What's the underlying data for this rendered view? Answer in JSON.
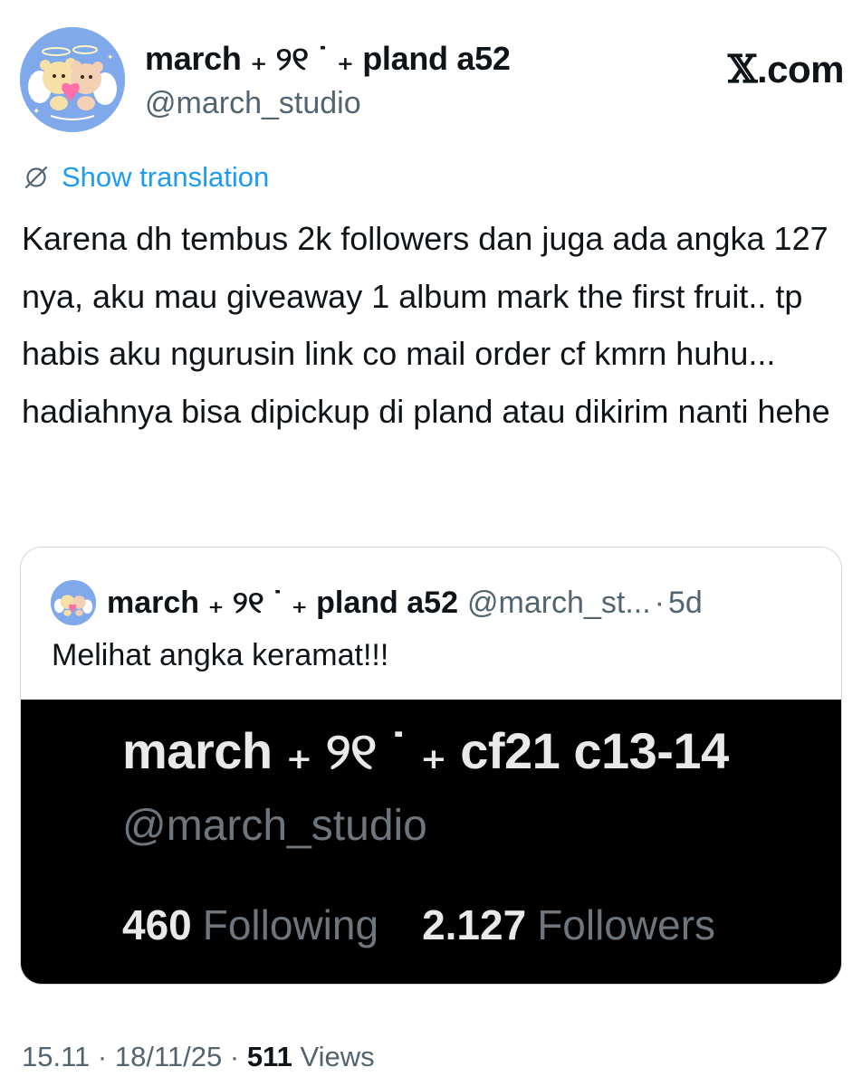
{
  "author": {
    "display_name": "march ₊ ୨୧ ˙ ₊ pland a52",
    "handle": "@march_studio"
  },
  "brand": {
    "x": "𝕏",
    "dot_com": ".com"
  },
  "icons": {
    "avatar": "avatar-illustration",
    "translate": "globe-slash-icon"
  },
  "translation": {
    "label": "Show translation"
  },
  "tweet": {
    "text": "Karena dh tembus 2k followers dan juga ada angka 127 nya, aku mau giveaway 1 album mark the first fruit.. tp habis aku ngurusin link co mail order cf kmrn huhu... hadiahnya bisa dipickup di pland atau dikirim nanti hehe"
  },
  "quote": {
    "display_name": "march ₊ ୨୧ ˙ ₊ pland a52",
    "handle": "@march_st...",
    "separator": "·",
    "time": "5d",
    "text": "Melihat angka keramat!!!",
    "image": {
      "name": "march ₊ ୨୧ ˙ ₊ cf21 c13-14",
      "handle": "@march_studio",
      "following_count": "460",
      "following_label": "Following",
      "followers_count": "2.127",
      "followers_label": "Followers"
    }
  },
  "meta": {
    "time": "15.11",
    "separator": "·",
    "date": "18/11/25",
    "views_count": "511",
    "views_label": "Views"
  }
}
